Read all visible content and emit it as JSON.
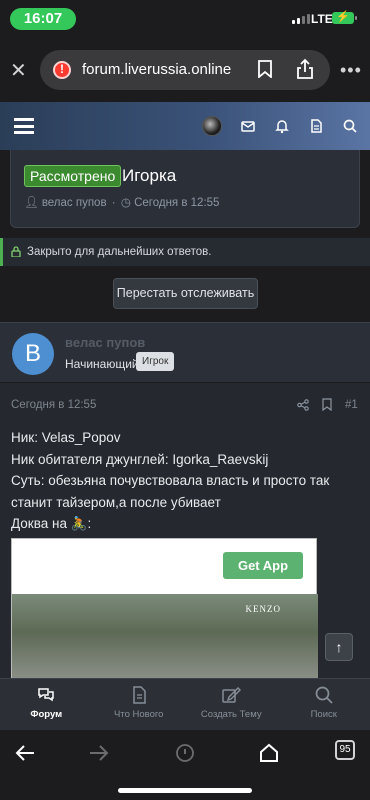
{
  "status_bar": {
    "time": "16:07",
    "network": "LTE"
  },
  "browser": {
    "url": "forum.liverussia.online"
  },
  "thread": {
    "status_tag": "Рассмотрено",
    "title": "Игорка",
    "author": "велас пупов",
    "date": "Сегодня в 12:55"
  },
  "closed_notice": "Закрыто для дальнейших ответов.",
  "watch_button": "Перестать отслеживать",
  "post": {
    "avatar_letter": "B",
    "author": "велас пупов",
    "role": "Начинающий",
    "badge": "Игрок",
    "date": "Сегодня в 12:55",
    "number": "#1",
    "lines": [
      "Ник: Velas_Popov",
      "Ник обитателя джунглей: Igorka_Raevskij",
      "Суть: обезьяна почувствовала власть и просто так станит тайзером,а после убивает",
      "Доква на 🚴:"
    ],
    "get_app_label": "Get App",
    "video_watermark": "KENZO"
  },
  "bottom_tabs": [
    {
      "label": "Форум",
      "icon": "comments-icon",
      "active": true
    },
    {
      "label": "Что Нового",
      "icon": "document-icon",
      "active": false
    },
    {
      "label": "Создать Тему",
      "icon": "edit-icon",
      "active": false
    },
    {
      "label": "Поиск",
      "icon": "search-icon",
      "active": false
    }
  ],
  "safari": {
    "tab_count": "95"
  },
  "colors": {
    "status_green": "#3c8a2f",
    "accent_blue": "#4e8fd2",
    "header_gradient_end": "#5a74a4"
  }
}
